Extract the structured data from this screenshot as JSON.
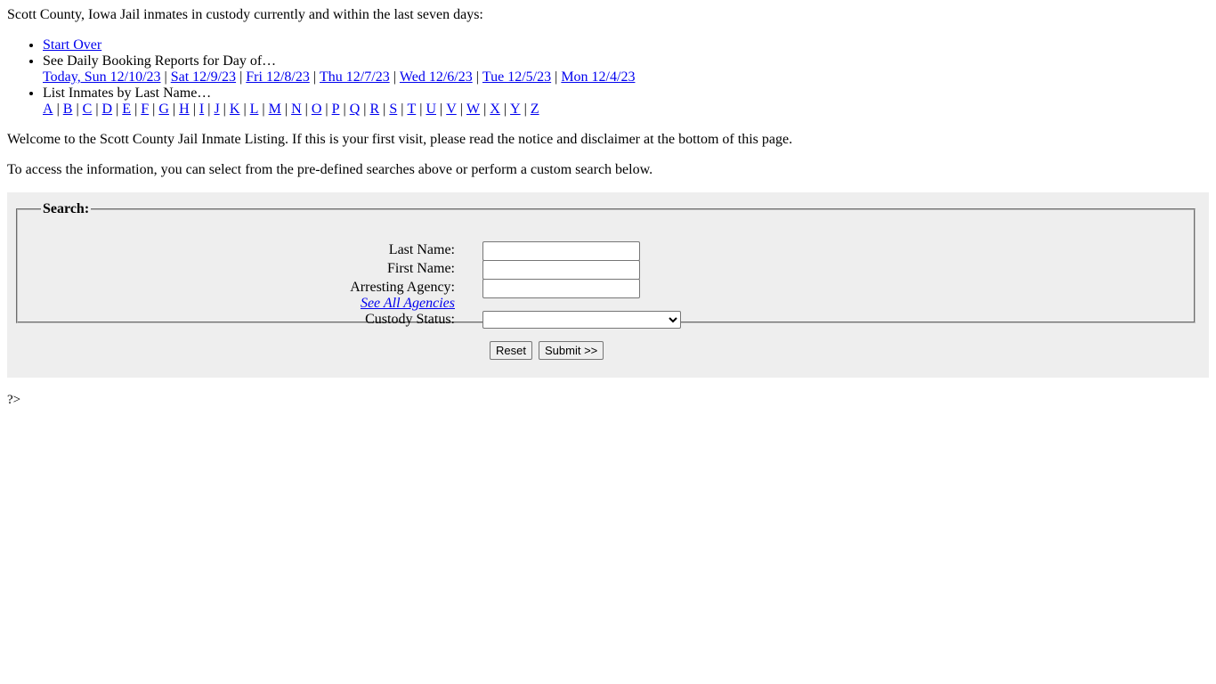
{
  "intro": "Scott County, Iowa Jail inmates in custody currently and within the last seven days:",
  "nav": {
    "start_over": "Start Over",
    "daily_label": "See Daily Booking Reports for Day of…",
    "days": [
      "Today, Sun 12/10/23",
      "Sat 12/9/23",
      "Fri 12/8/23",
      "Thu 12/7/23",
      "Wed 12/6/23",
      "Tue 12/5/23",
      "Mon 12/4/23"
    ],
    "lastname_label": "List Inmates by Last Name…",
    "letters": [
      "A",
      "B",
      "C",
      "D",
      "E",
      "F",
      "G",
      "H",
      "I",
      "J",
      "K",
      "L",
      "M",
      "N",
      "O",
      "P",
      "Q",
      "R",
      "S",
      "T",
      "U",
      "V",
      "W",
      "X",
      "Y",
      "Z"
    ],
    "separator": "|"
  },
  "welcome": "Welcome to the Scott County Jail Inmate Listing. If this is your first visit, please read the notice and disclaimer at the bottom of this page.",
  "access": "To access the information, you can select from the pre-defined searches above or perform a custom search below.",
  "search": {
    "legend": "Search:",
    "last_name_label": "Last Name:",
    "last_name_value": "",
    "first_name_label": "First Name:",
    "first_name_value": "",
    "agency_label": "Arresting Agency:",
    "agency_value": "",
    "see_all_agencies": "See All Agencies",
    "custody_label": "Custody Status:",
    "custody_value": "",
    "reset_label": "Reset",
    "submit_label": "Submit >>"
  },
  "tail": "?>"
}
